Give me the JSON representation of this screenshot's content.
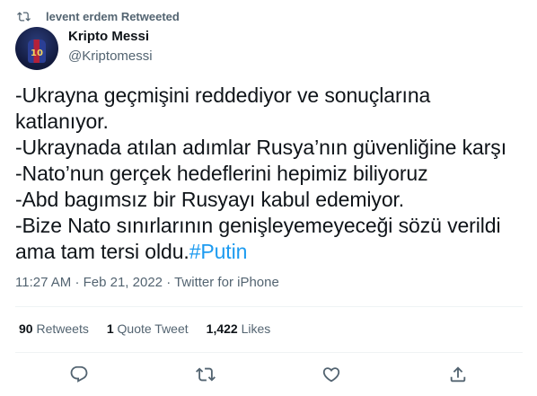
{
  "retweet": {
    "label": "levent erdem Retweeted",
    "icon": "retweet-icon"
  },
  "author": {
    "name": "Kripto Messi",
    "handle": "@Kriptomessi",
    "avatar_number": "10"
  },
  "tweet": {
    "lines": [
      "-Ukrayna geçmişini reddediyor ve sonuçlarına",
      "katlanıyor.",
      "-Ukraynada atılan adımlar Rusya’nın güvenliğine karşı",
      "-Nato’nun gerçek hedeflerini hepimiz biliyoruz",
      "-Abd bagımsız bir Rusyayı kabul edemiyor.",
      "-Bize Nato sınırlarının genişleyemeyeceği sözü verildi",
      "ama tam tersi oldu."
    ],
    "hashtag": "#Putin"
  },
  "meta": {
    "time": "11:27 AM",
    "separator1": "·",
    "date": "Feb 21, 2022",
    "separator2": "·",
    "source": "Twitter for iPhone"
  },
  "stats": {
    "retweets_count": "90",
    "retweets_label": "Retweets",
    "quotes_count": "1",
    "quotes_label": "Quote Tweet",
    "likes_count": "1,422",
    "likes_label": "Likes"
  },
  "actions": {
    "reply_icon": "reply-icon",
    "retweet_icon": "retweet-icon",
    "like_icon": "heart-icon",
    "share_icon": "share-icon"
  },
  "colors": {
    "text": "#0f1419",
    "secondary": "#536471",
    "link": "#1d9bf0",
    "divider": "#eff3f4"
  }
}
